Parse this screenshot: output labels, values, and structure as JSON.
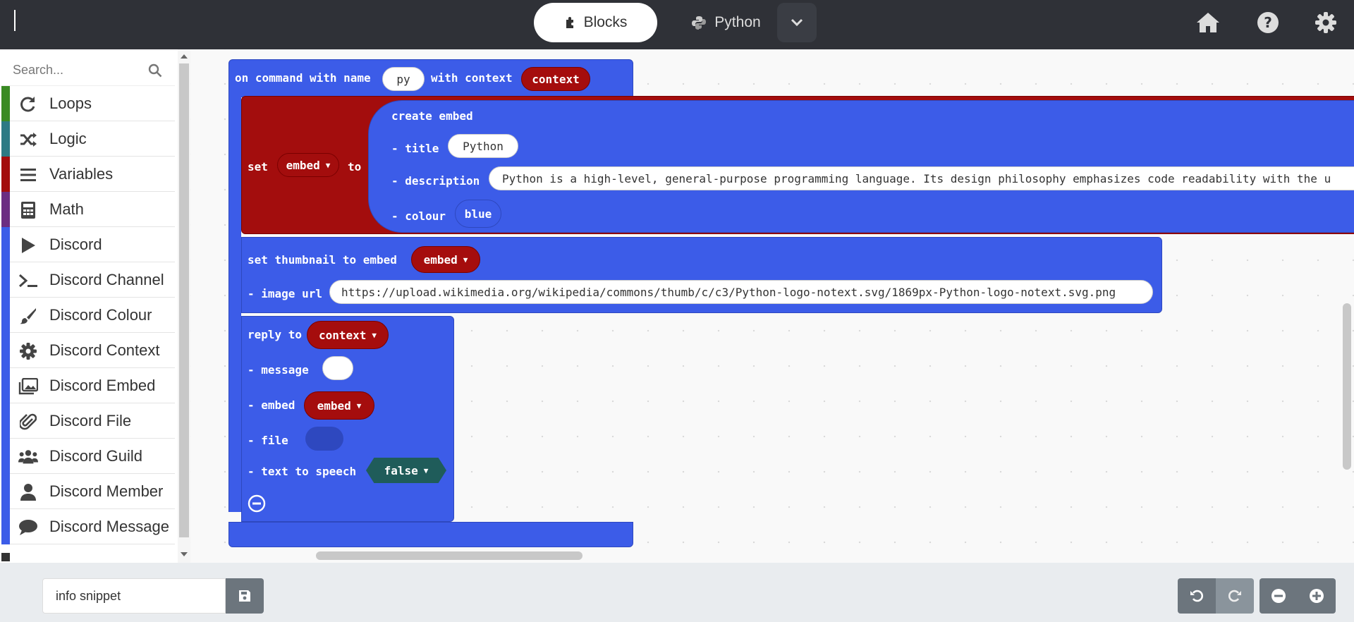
{
  "header": {
    "tabs": [
      {
        "label": "Blocks",
        "icon": "puzzle-icon",
        "active": true
      },
      {
        "label": "Python",
        "icon": "python-icon",
        "active": false
      }
    ],
    "icons": [
      "home-icon",
      "help-icon",
      "gear-icon"
    ]
  },
  "toolbox": {
    "search_placeholder": "Search...",
    "categories": [
      {
        "label": "Loops",
        "color": "#3a8a23",
        "icon": "loop-icon"
      },
      {
        "label": "Logic",
        "color": "#2d7a84",
        "icon": "shuffle-icon"
      },
      {
        "label": "Variables",
        "color": "#a30d0d",
        "icon": "list-icon"
      },
      {
        "label": "Math",
        "color": "#6b2d82",
        "icon": "calculator-icon"
      },
      {
        "label": "Discord",
        "color": "#3c5ce8",
        "icon": "play-icon"
      },
      {
        "label": "Discord Channel",
        "color": "#3c5ce8",
        "icon": "terminal-icon"
      },
      {
        "label": "Discord Colour",
        "color": "#3c5ce8",
        "icon": "brush-icon"
      },
      {
        "label": "Discord Context",
        "color": "#3c5ce8",
        "icon": "gear-icon"
      },
      {
        "label": "Discord Embed",
        "color": "#3c5ce8",
        "icon": "images-icon"
      },
      {
        "label": "Discord File",
        "color": "#3c5ce8",
        "icon": "paperclip-icon"
      },
      {
        "label": "Discord Guild",
        "color": "#3c5ce8",
        "icon": "users-icon"
      },
      {
        "label": "Discord Member",
        "color": "#3c5ce8",
        "icon": "user-icon"
      },
      {
        "label": "Discord Message",
        "color": "#3c5ce8",
        "icon": "comment-icon"
      }
    ]
  },
  "workspace": {
    "command_block": {
      "prefix": "on command with name",
      "name": "py",
      "with_context": "with context",
      "context_var": "context"
    },
    "set_block": {
      "set": "set",
      "var": "embed",
      "to": "to"
    },
    "create_embed": {
      "header": "create embed",
      "title_label": "- title",
      "title_value": "Python",
      "description_label": "- description",
      "description_value": "Python is a high-level, general-purpose programming language. Its design philosophy emphasizes code readability with the u",
      "colour_label": "- colour",
      "colour_value": "blue"
    },
    "thumbnail_block": {
      "header": "set thumbnail to embed",
      "var": "embed",
      "image_url_label": "- image url",
      "image_url_value": "https://upload.wikimedia.org/wikipedia/commons/thumb/c/c3/Python-logo-notext.svg/1869px-Python-logo-notext.svg.png"
    },
    "reply_block": {
      "header": "reply to",
      "target": "context",
      "message_label": "- message",
      "message_value": "",
      "embed_label": "- embed",
      "embed_value": "embed",
      "file_label": "- file",
      "tts_label": "- text to speech",
      "tts_value": "false"
    },
    "colors": {
      "discord_blue": "#3c5ce8",
      "variable_red": "#a30d0d",
      "logic_teal": "#1f5c5a"
    }
  },
  "bottom": {
    "snippet_name": "info snippet",
    "icons": [
      "save-icon",
      "undo-icon",
      "redo-icon",
      "zoom-out-icon",
      "zoom-in-icon"
    ]
  }
}
